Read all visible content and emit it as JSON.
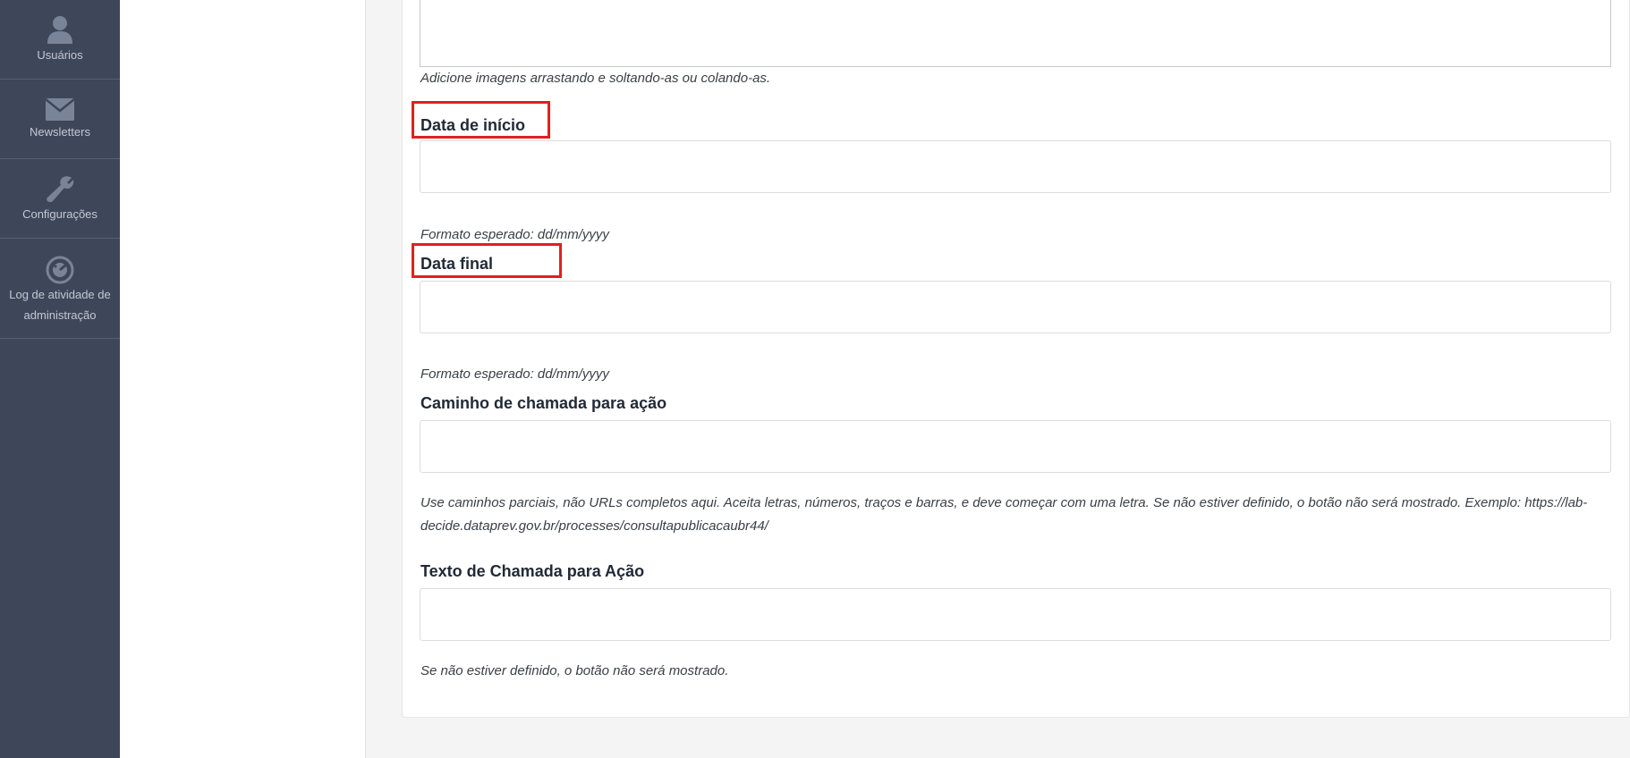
{
  "sidebar": {
    "items": [
      {
        "label": "Usuários",
        "icon": "user-icon"
      },
      {
        "label": "Newsletters",
        "icon": "envelope-icon"
      },
      {
        "label": "Configurações",
        "icon": "wrench-icon"
      },
      {
        "label": "Log de atividade de administração",
        "icon": "activity-log-icon"
      }
    ]
  },
  "form": {
    "description_help": "Adicione imagens arrastando e soltando-as ou colando-as.",
    "start_date": {
      "label": "Data de início",
      "value": "",
      "help": "Formato esperado: dd/mm/yyyy"
    },
    "end_date": {
      "label": "Data final",
      "value": "",
      "help": "Formato esperado: dd/mm/yyyy"
    },
    "cta_path": {
      "label": "Caminho de chamada para ação",
      "value": "",
      "help": "Use caminhos parciais, não URLs completos aqui. Aceita letras, números, traços e barras, e deve começar com uma letra. Se não estiver definido, o botão não será mostrado. Exemplo: https://lab-decide.dataprev.gov.br/processes/consultapublicacaubr44/"
    },
    "cta_text": {
      "label": "Texto de Chamada para Ação",
      "value": "",
      "help": "Se não estiver definido, o botão não será mostrado."
    }
  },
  "colors": {
    "sidebar_bg": "#3e4659",
    "highlight": "#e21f1f"
  }
}
